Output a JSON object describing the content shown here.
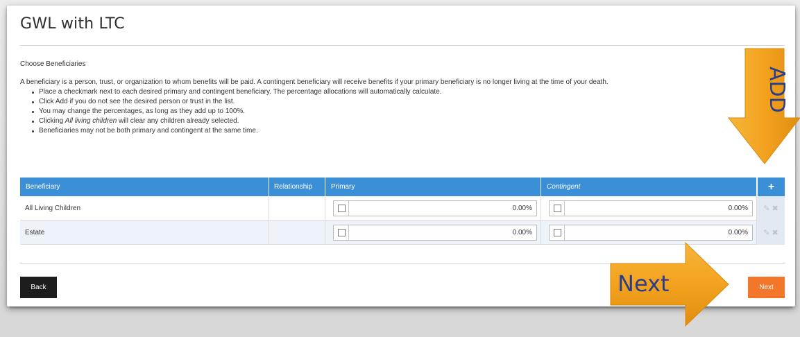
{
  "page": {
    "title": "GWL with LTC",
    "section_label": "Choose Beneficiaries",
    "intro": "A beneficiary is a person, trust, or organization to whom benefits will be paid. A contingent beneficiary will receive benefits if your primary beneficiary is no longer living at the time of your death.",
    "bullets": {
      "b1": "Place a checkmark next to each desired primary and contingent beneficiary. The percentage allocations will automatically calculate.",
      "b2": "Click Add if you do not see the desired person or trust in the list.",
      "b3": "You may change the percentages, as long as they add up to 100%.",
      "b4_prefix": "Clicking ",
      "b4_em": "All living children",
      "b4_suffix": " will clear any children already selected.",
      "b5": "Beneficiaries may not be both primary and contingent at the same time."
    }
  },
  "table": {
    "headers": {
      "beneficiary": "Beneficiary",
      "relationship": "Relationship",
      "primary": "Primary",
      "contingent": "Contingent",
      "add_icon": "plus-icon"
    },
    "rows": [
      {
        "name": "All Living Children",
        "relationship": "",
        "primary_checked": false,
        "primary_pct": "0.00%",
        "contingent_checked": false,
        "contingent_pct": "0.00%"
      },
      {
        "name": "Estate",
        "relationship": "",
        "primary_checked": false,
        "primary_pct": "0.00%",
        "contingent_checked": false,
        "contingent_pct": "0.00%"
      }
    ],
    "row_icons": [
      "pencil-icon",
      "x-icon"
    ]
  },
  "buttons": {
    "back": "Back",
    "next": "Next"
  },
  "callouts": {
    "add": "ADD",
    "next": "Next",
    "arrow_color": "#f5a623",
    "text_color": "#2a3d8a"
  },
  "colors": {
    "header_blue": "#3a8fd6",
    "next_orange": "#f2772b",
    "back_black": "#1d1d1d"
  }
}
